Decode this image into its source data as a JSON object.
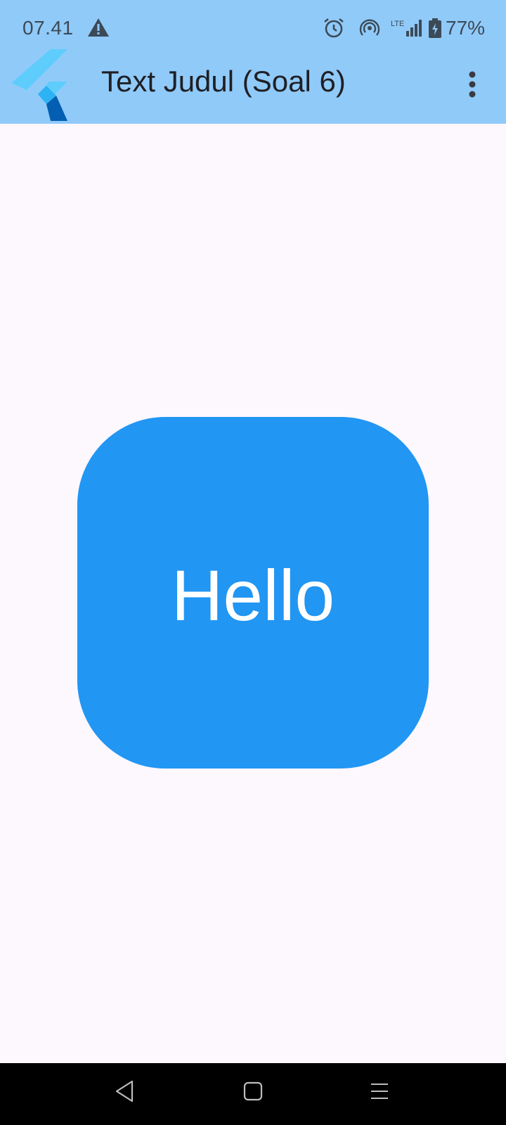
{
  "status_bar": {
    "time": "07.41",
    "network_label": "LTE",
    "battery_percent": "77%",
    "icons": [
      "warning-icon",
      "alarm-icon",
      "hotspot-icon",
      "signal-icon",
      "battery-charging-icon"
    ]
  },
  "app_bar": {
    "title": "Text Judul (Soal 6)",
    "logo": "flutter-logo",
    "menu_icon": "more-vert-icon"
  },
  "main": {
    "box_text": "Hello",
    "box_color": "#2196F3"
  },
  "colors": {
    "app_bar": "#90CAF9",
    "background": "#FDF7FE",
    "nav_bar": "#000000"
  },
  "nav_bar": {
    "icons": [
      "back-icon",
      "home-icon",
      "recents-icon"
    ]
  }
}
